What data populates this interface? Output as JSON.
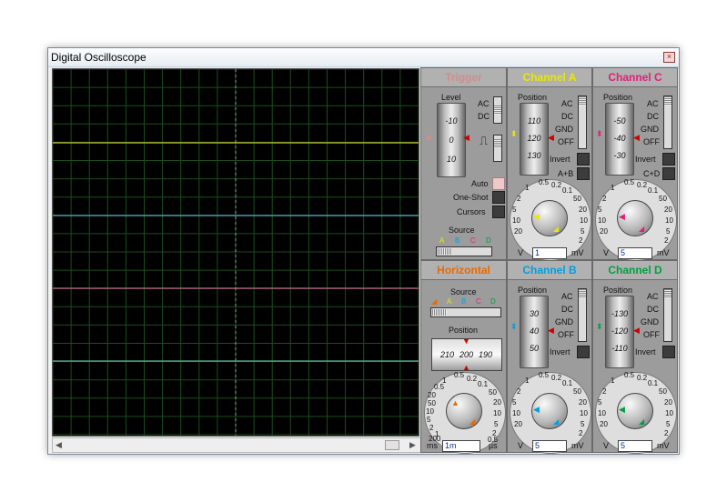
{
  "window": {
    "title": "Digital Oscilloscope",
    "close_glyph": "×"
  },
  "scrollbar": {
    "left_arrow": "◀",
    "right_arrow": "▶"
  },
  "colors": {
    "channel_a": "#e8e800",
    "channel_b": "#00a0e0",
    "channel_c": "#e0207a",
    "channel_d": "#00a040",
    "trigger": "#d28c8c",
    "horizontal": "#e86a00",
    "trace_a": "#c9c93a",
    "trace_b": "#4fb4c8",
    "trace_c": "#c86a8c",
    "trace_d": "#55b894",
    "grid": "#1d4d1d"
  },
  "trigger": {
    "title": "Trigger",
    "level_label": "Level",
    "level_ticks": [
      "-10",
      "0",
      "10"
    ],
    "ac": "AC",
    "dc": "DC",
    "auto": "Auto",
    "one_shot": "One-Shot",
    "cursors": "Cursors",
    "source_label": "Source",
    "source_letters": [
      "A",
      "B",
      "C",
      "D"
    ]
  },
  "horizontal": {
    "title": "Horizontal",
    "source_label": "Source",
    "source_letters": [
      "A",
      "B",
      "C",
      "D"
    ],
    "position_label": "Position",
    "position_ticks": [
      "210",
      "200",
      "190"
    ],
    "dial_labels": [
      "0.5",
      "0.2",
      "0.1",
      "50",
      "20",
      "10",
      "5",
      "2",
      "1",
      "0.5",
      "20",
      "50",
      "10",
      "5",
      "2",
      "1",
      "200",
      "0.5"
    ],
    "unit_left": "ms",
    "unit_right": "µs",
    "value": "1m"
  },
  "channel_a": {
    "title": "Channel A",
    "position_label": "Position",
    "ticks": [
      "110",
      "120",
      "130"
    ],
    "ac": "AC",
    "dc": "DC",
    "gnd": "GND",
    "off": "OFF",
    "invert": "Invert",
    "combine": "A+B",
    "unit_left": "V",
    "unit_right": "mV",
    "value": "1",
    "dial_labels": [
      "0.5",
      "0.2",
      "0.1",
      "50",
      "20",
      "10",
      "5",
      "2",
      "1",
      "2",
      "5",
      "10",
      "20"
    ]
  },
  "channel_b": {
    "title": "Channel B",
    "position_label": "Position",
    "ticks": [
      "30",
      "40",
      "50"
    ],
    "ac": "AC",
    "dc": "DC",
    "gnd": "GND",
    "off": "OFF",
    "invert": "Invert",
    "unit_left": "V",
    "unit_right": "mV",
    "value": "5",
    "dial_labels": [
      "0.5",
      "0.2",
      "0.1",
      "50",
      "20",
      "10",
      "5",
      "2",
      "1",
      "2",
      "5",
      "10",
      "20"
    ]
  },
  "channel_c": {
    "title": "Channel C",
    "position_label": "Position",
    "ticks": [
      "-50",
      "-40",
      "-30"
    ],
    "ac": "AC",
    "dc": "DC",
    "gnd": "GND",
    "off": "OFF",
    "invert": "Invert",
    "combine": "C+D",
    "unit_left": "V",
    "unit_right": "mV",
    "value": "5",
    "dial_labels": [
      "0.5",
      "0.2",
      "0.1",
      "50",
      "20",
      "10",
      "5",
      "2",
      "1",
      "2",
      "5",
      "10",
      "20"
    ]
  },
  "channel_d": {
    "title": "Channel D",
    "position_label": "Position",
    "ticks": [
      "-130",
      "-120",
      "-110"
    ],
    "ac": "AC",
    "dc": "DC",
    "gnd": "GND",
    "off": "OFF",
    "invert": "Invert",
    "unit_left": "V",
    "unit_right": "mV",
    "value": "5",
    "dial_labels": [
      "0.5",
      "0.2",
      "0.1",
      "50",
      "20",
      "10",
      "5",
      "2",
      "1",
      "2",
      "5",
      "10",
      "20"
    ]
  }
}
